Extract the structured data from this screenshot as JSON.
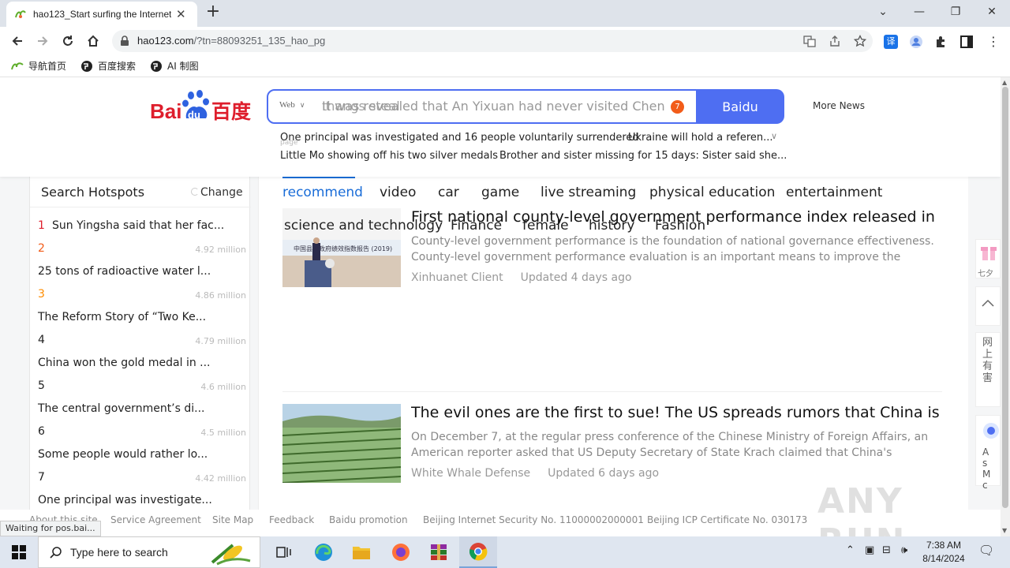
{
  "browser": {
    "tab_title": "hao123_Start surfing the Internet",
    "url_host": "hao123.com",
    "url_rest": "/?tn=88093251_135_hao_pg",
    "bookmarks": [
      "导航首页",
      "百度搜索",
      "AI 制图"
    ]
  },
  "header": {
    "search_scope": "Web",
    "search_query": "It was revealed that An Yixuan had never visited Chen",
    "search_ghost": "thangs steal",
    "badge_count": "7",
    "search_button": "Baidu",
    "more_news": "More News",
    "hot_lines": [
      "One principal was investigated and 16 people voluntarily surrendered",
      "Ukraine will hold a referen...",
      "Little Mo showing off his two silver medals",
      "Brother and sister missing for 15 days: Sister said she..."
    ],
    "page_ghost": "page"
  },
  "sidebar": {
    "title": "Search Hotspots",
    "change": "Change",
    "items": [
      {
        "rank": "1",
        "text": "Sun Yingsha said that her fac...",
        "metric": ""
      },
      {
        "rank": "2",
        "text": "",
        "metric": "4.92 million"
      },
      {
        "rank": "",
        "text": "25 tons of radioactive water l...",
        "metric": ""
      },
      {
        "rank": "3",
        "text": "",
        "metric": "4.86 million"
      },
      {
        "rank": "",
        "text": "The Reform Story of “Two Ke...",
        "metric": ""
      },
      {
        "rank": "4",
        "text": "",
        "metric": "4.79 million"
      },
      {
        "rank": "",
        "text": "China won the gold medal in ...",
        "metric": ""
      },
      {
        "rank": "5",
        "text": "",
        "metric": "4.6 million"
      },
      {
        "rank": "",
        "text": "The central government’s di...",
        "metric": ""
      },
      {
        "rank": "6",
        "text": "",
        "metric": "4.5 million"
      },
      {
        "rank": "",
        "text": "Some people would rather lo...",
        "metric": ""
      },
      {
        "rank": "7",
        "text": "",
        "metric": "4.42 million"
      },
      {
        "rank": "",
        "text": "One principal was investigate...",
        "metric": ""
      }
    ]
  },
  "main": {
    "tabs": [
      "recommend",
      "video",
      "car",
      "game",
      "live streaming",
      "physical education",
      "entertainment"
    ],
    "subtabs": [
      "science and technology",
      "Finance",
      "female",
      "history",
      "Fashion"
    ],
    "articles": [
      {
        "title": "First national county-level government performance index released in Beijing",
        "desc": "County-level government performance is the foundation of national governance effectiveness. County-level government performance evaluation is an important means to improve the",
        "source": "Xinhuanet Client",
        "updated": "Updated 4 days ago"
      },
      {
        "title": "The evil ones are the first to sue! The US spreads rumors that China is \"the le...",
        "desc": "On December 7, at the regular press conference of the Chinese Ministry of Foreign Affairs, an American reporter asked that US Deputy Secretary of State Krach claimed that China's",
        "source": "White Whale Defense",
        "updated": "Updated 6 days ago"
      }
    ]
  },
  "right_float": {
    "label1": "七夕",
    "label3": "网上有害",
    "label4": "As Mc"
  },
  "footer": {
    "links": [
      "About this site",
      "Service Agreement",
      "Site Map",
      "Feedback",
      "Baidu promotion",
      "Beijing Internet Security No. 11000002000001",
      "Beijing ICP Certificate No. 030173"
    ],
    "status": "Waiting for pos.bai...",
    "watermark": "ANY RUN"
  },
  "taskbar": {
    "search_placeholder": "Type here to search",
    "time": "7:38 AM",
    "date": "8/14/2024"
  },
  "colors": {
    "baidu_blue": "#4e6ef2",
    "baidu_red": "#de1e2c",
    "accent_link": "#1a6dd8",
    "rank_hot": "#f25c19",
    "rank_warm": "#ff8c00"
  }
}
